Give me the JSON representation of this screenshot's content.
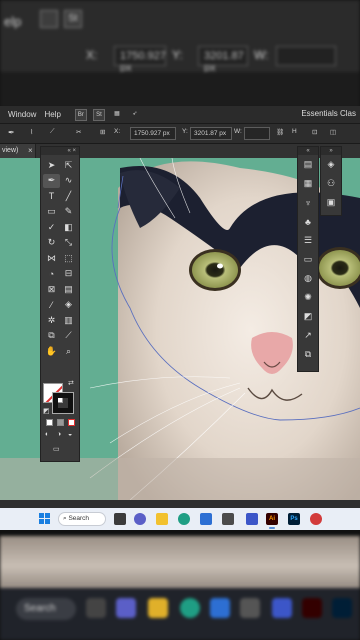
{
  "background": {
    "top_options": {
      "x_label": "X:",
      "x_value": "1750.927 px",
      "y_label": "Y:",
      "y_value": "3201.87 px",
      "w_label": "W:"
    },
    "taskbar": {
      "search_label": "Search"
    }
  },
  "menubar": {
    "items": [
      "Window",
      "Help"
    ],
    "app_buttons": [
      "Br",
      "St"
    ],
    "workspace": "Essentials Clas"
  },
  "optionsbar": {
    "x_label": "X:",
    "x_value": "1750.927 px",
    "y_label": "Y:",
    "y_value": "3201.87 px",
    "w_label": "W:"
  },
  "document_tab": {
    "label": "view)",
    "close": "×"
  },
  "tools_panel": {
    "collapse": "«",
    "close": "×"
  },
  "taskbar": {
    "search_label": "Search",
    "apps": [
      {
        "name": "task-view",
        "color": "#3b3b3b",
        "glyph": ""
      },
      {
        "name": "teams",
        "color": "#5b5fc7",
        "glyph": ""
      },
      {
        "name": "file-explorer",
        "color": "#f2c12e",
        "glyph": ""
      },
      {
        "name": "edge",
        "color": "#1f9e84",
        "glyph": ""
      },
      {
        "name": "store",
        "color": "#2d6fd3",
        "glyph": ""
      },
      {
        "name": "app-cube",
        "color": "#4b4b4b",
        "glyph": ""
      },
      {
        "name": "app-blue",
        "color": "#3c56c8",
        "glyph": ""
      },
      {
        "name": "illustrator",
        "color": "#330000",
        "glyph": "Ai"
      },
      {
        "name": "photoshop",
        "color": "#001e36",
        "glyph": "Ps"
      },
      {
        "name": "app-multicolor",
        "color": "#d23b3b",
        "glyph": ""
      }
    ]
  },
  "colors": {
    "canvas_green": "#63ae92",
    "ui_dark": "#323232",
    "accent_red": "#e03030"
  }
}
